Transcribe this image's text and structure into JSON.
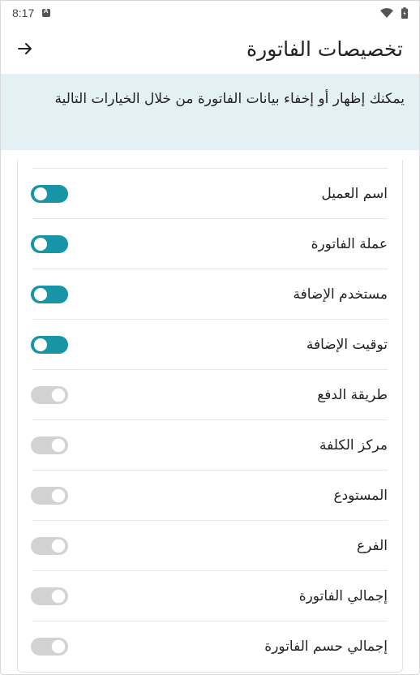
{
  "status_bar": {
    "time": "8:17"
  },
  "app_bar": {
    "title": "تخصيصات الفاتورة",
    "back_icon": "arrow-back-icon"
  },
  "banner": {
    "text": "يمكنك إظهار أو إخفاء بيانات الفاتورة من خلال الخيارات التالية"
  },
  "colors": {
    "accent": "#1795a6",
    "banner_bg": "#e3f1f5",
    "toggle_off": "#d2d2d2"
  },
  "settings": [
    {
      "label": "اسم العميل",
      "enabled": true
    },
    {
      "label": "عملة الفاتورة",
      "enabled": true
    },
    {
      "label": "مستخدم الإضافة",
      "enabled": true
    },
    {
      "label": "توقيت الإضافة",
      "enabled": true
    },
    {
      "label": "طريقة الدفع",
      "enabled": false
    },
    {
      "label": "مركز الكلفة",
      "enabled": false
    },
    {
      "label": "المستودع",
      "enabled": false
    },
    {
      "label": "الفرع",
      "enabled": false
    },
    {
      "label": "إجمالي الفاتورة",
      "enabled": false
    },
    {
      "label": "إجمالي حسم الفاتورة",
      "enabled": false
    }
  ]
}
